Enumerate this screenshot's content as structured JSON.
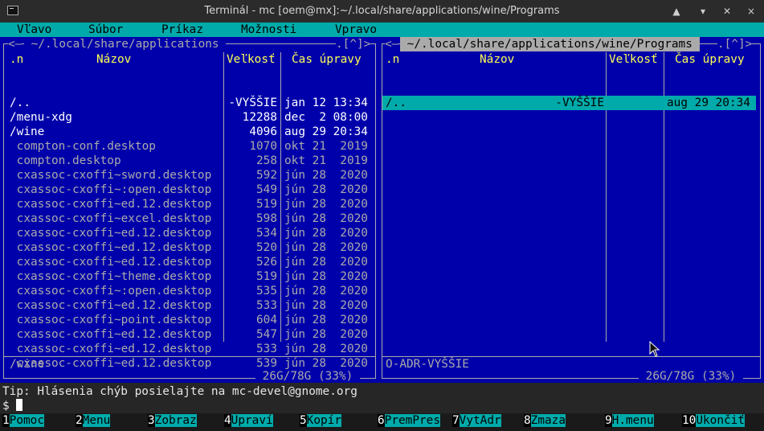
{
  "window": {
    "title": "Terminál - mc [oem@mx]:~/.local/share/applications/wine/Programs",
    "controls": [
      "▲",
      "▾",
      "✕",
      "×"
    ]
  },
  "menubar": {
    "items": [
      "Vľavo",
      "Súbor",
      "Príkaz",
      "Možnosti",
      "Vpravo"
    ]
  },
  "left_panel": {
    "title": " ~/.local/share/applications ",
    "left_mark": "<—",
    "right_mark": ".[^]>",
    "columns": [
      ".n",
      "Názov",
      "Veľkosť",
      "Čas úpravy"
    ],
    "rows": [
      {
        "name": "/..",
        "size": "-VYŠŠIE",
        "date": "jan 12 13:34",
        "kind": "dir"
      },
      {
        "name": "/menu-xdg",
        "size": "12288",
        "date": "dec  2 08:00",
        "kind": "dir"
      },
      {
        "name": "/wine",
        "size": "4096",
        "date": "aug 29 20:34",
        "kind": "dir"
      },
      {
        "name": " compton-conf.desktop",
        "size": "1070",
        "date": "okt 21  2019",
        "kind": "file"
      },
      {
        "name": " compton.desktop",
        "size": "258",
        "date": "okt 21  2019",
        "kind": "file"
      },
      {
        "name": " cxassoc-cxoffi~sword.desktop",
        "size": "592",
        "date": "jún 28  2020",
        "kind": "file"
      },
      {
        "name": " cxassoc-cxoffi~:open.desktop",
        "size": "549",
        "date": "jún 28  2020",
        "kind": "file"
      },
      {
        "name": " cxassoc-cxoffi~ed.12.desktop",
        "size": "519",
        "date": "jún 28  2020",
        "kind": "file"
      },
      {
        "name": " cxassoc-cxoffi~excel.desktop",
        "size": "598",
        "date": "jún 28  2020",
        "kind": "file"
      },
      {
        "name": " cxassoc-cxoffi~ed.12.desktop",
        "size": "534",
        "date": "jún 28  2020",
        "kind": "file"
      },
      {
        "name": " cxassoc-cxoffi~ed.12.desktop",
        "size": "520",
        "date": "jún 28  2020",
        "kind": "file"
      },
      {
        "name": " cxassoc-cxoffi~ed.12.desktop",
        "size": "526",
        "date": "jún 28  2020",
        "kind": "file"
      },
      {
        "name": " cxassoc-cxoffi~theme.desktop",
        "size": "519",
        "date": "jún 28  2020",
        "kind": "file"
      },
      {
        "name": " cxassoc-cxoffi~:open.desktop",
        "size": "535",
        "date": "jún 28  2020",
        "kind": "file"
      },
      {
        "name": " cxassoc-cxoffi~ed.12.desktop",
        "size": "533",
        "date": "jún 28  2020",
        "kind": "file"
      },
      {
        "name": " cxassoc-cxoffi~point.desktop",
        "size": "604",
        "date": "jún 28  2020",
        "kind": "file"
      },
      {
        "name": " cxassoc-cxoffi~ed.12.desktop",
        "size": "547",
        "date": "jún 28  2020",
        "kind": "file"
      },
      {
        "name": " cxassoc-cxoffi~ed.12.desktop",
        "size": "533",
        "date": "jún 28  2020",
        "kind": "file"
      },
      {
        "name": " cxassoc-cxoffi~ed.12.desktop",
        "size": "539",
        "date": "jún 28  2020",
        "kind": "file"
      }
    ],
    "status": "/wine",
    "disk": " 26G/78G (33%) "
  },
  "right_panel": {
    "title": " ~/.local/share/applications/wine/Programs ",
    "left_mark": "<—",
    "right_mark": ".[^]>",
    "columns": [
      ".n",
      "Názov",
      "Veľkosť",
      "Čas úpravy"
    ],
    "rows": [
      {
        "name": "/..",
        "size": "-VYŠŠIE",
        "date": "aug 29 20:34",
        "kind": "selected"
      }
    ],
    "status": "O-ADR-VYŠŠIE",
    "disk": " 26G/78G (33%) "
  },
  "command": {
    "tip": "Tip: Hlásenia chýb posielajte na mc-devel@gnome.org",
    "prompt": "$ "
  },
  "fkeys": [
    {
      "num": "1",
      "label": "Pomoc"
    },
    {
      "num": "2",
      "label": "Menu"
    },
    {
      "num": "3",
      "label": "Zobraz"
    },
    {
      "num": "4",
      "label": "Upraví"
    },
    {
      "num": "5",
      "label": "Kopír"
    },
    {
      "num": "6",
      "label": "PremPres"
    },
    {
      "num": "7",
      "label": "VytAdr"
    },
    {
      "num": "8",
      "label": "Zmaza"
    },
    {
      "num": "9",
      "label": "H.menu"
    },
    {
      "num": "10",
      "label": "Ukončiť"
    }
  ],
  "colors": {
    "background": "#0000aa",
    "accent": "#00aaaa",
    "header": "#ffff55",
    "directory": "#ffffff",
    "file": "#aaaaaa"
  }
}
